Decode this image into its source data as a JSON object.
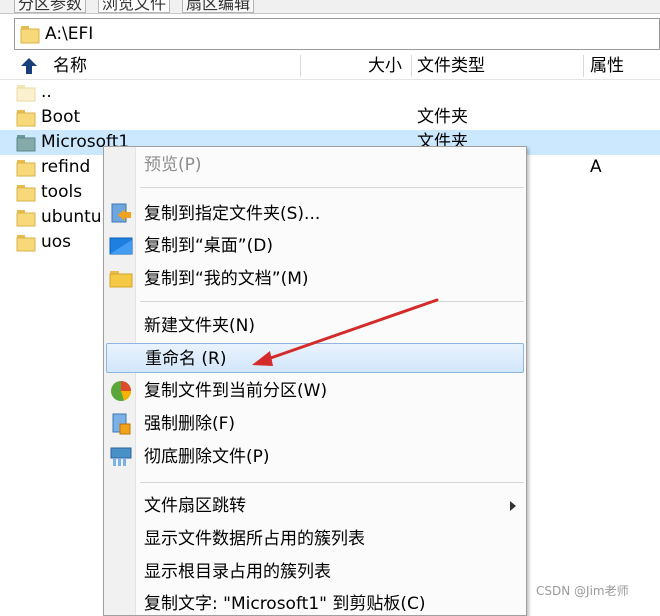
{
  "tabs": [
    "分区参数",
    "浏览文件",
    "扇区编辑"
  ],
  "path": {
    "value": "A:\\EFI"
  },
  "columns": {
    "name": "名称",
    "size": "大小",
    "type": "文件类型",
    "attr": "属性"
  },
  "files": [
    {
      "name": "..",
      "type": "",
      "attr": "",
      "icon": "parent-folder-icon"
    },
    {
      "name": "Boot",
      "type": "文件夹",
      "attr": "",
      "icon": "folder-icon"
    },
    {
      "name": "Microsoft1",
      "type": "文件夹",
      "attr": "",
      "icon": "folder-icon",
      "selected": true
    },
    {
      "name": "refind",
      "type": "",
      "attr": "A",
      "icon": "folder-icon"
    },
    {
      "name": "tools",
      "type": "",
      "attr": "",
      "icon": "folder-icon"
    },
    {
      "name": "ubuntu",
      "type": "",
      "attr": "",
      "icon": "folder-icon"
    },
    {
      "name": "uos",
      "type": "",
      "attr": "",
      "icon": "folder-icon"
    }
  ],
  "menu": {
    "preview": "预览(P)",
    "copy_to_folder": "复制到指定文件夹(S)...",
    "copy_to_desktop": "复制到“桌面”(D)",
    "copy_to_documents": "复制到“我的文档”(M)",
    "new_folder": "新建文件夹(N)",
    "rename": "重命名 (R)",
    "copy_to_partition": "复制文件到当前分区(W)",
    "force_delete": "强制删除(F)",
    "wipe_delete": "彻底删除文件(P)",
    "sector_jump": "文件扇区跳转",
    "show_clusters": "显示文件数据所占用的簇列表",
    "show_root_clusters": "显示根目录占用的簇列表",
    "copy_text": "复制文字: \"Microsoft1\" 到剪贴板(C)"
  },
  "watermark": "CSDN @Jim老师",
  "colors": {
    "accent_arrow": "#d42a2a",
    "selection": "#cce8ff",
    "folder": "#f7d97a"
  }
}
